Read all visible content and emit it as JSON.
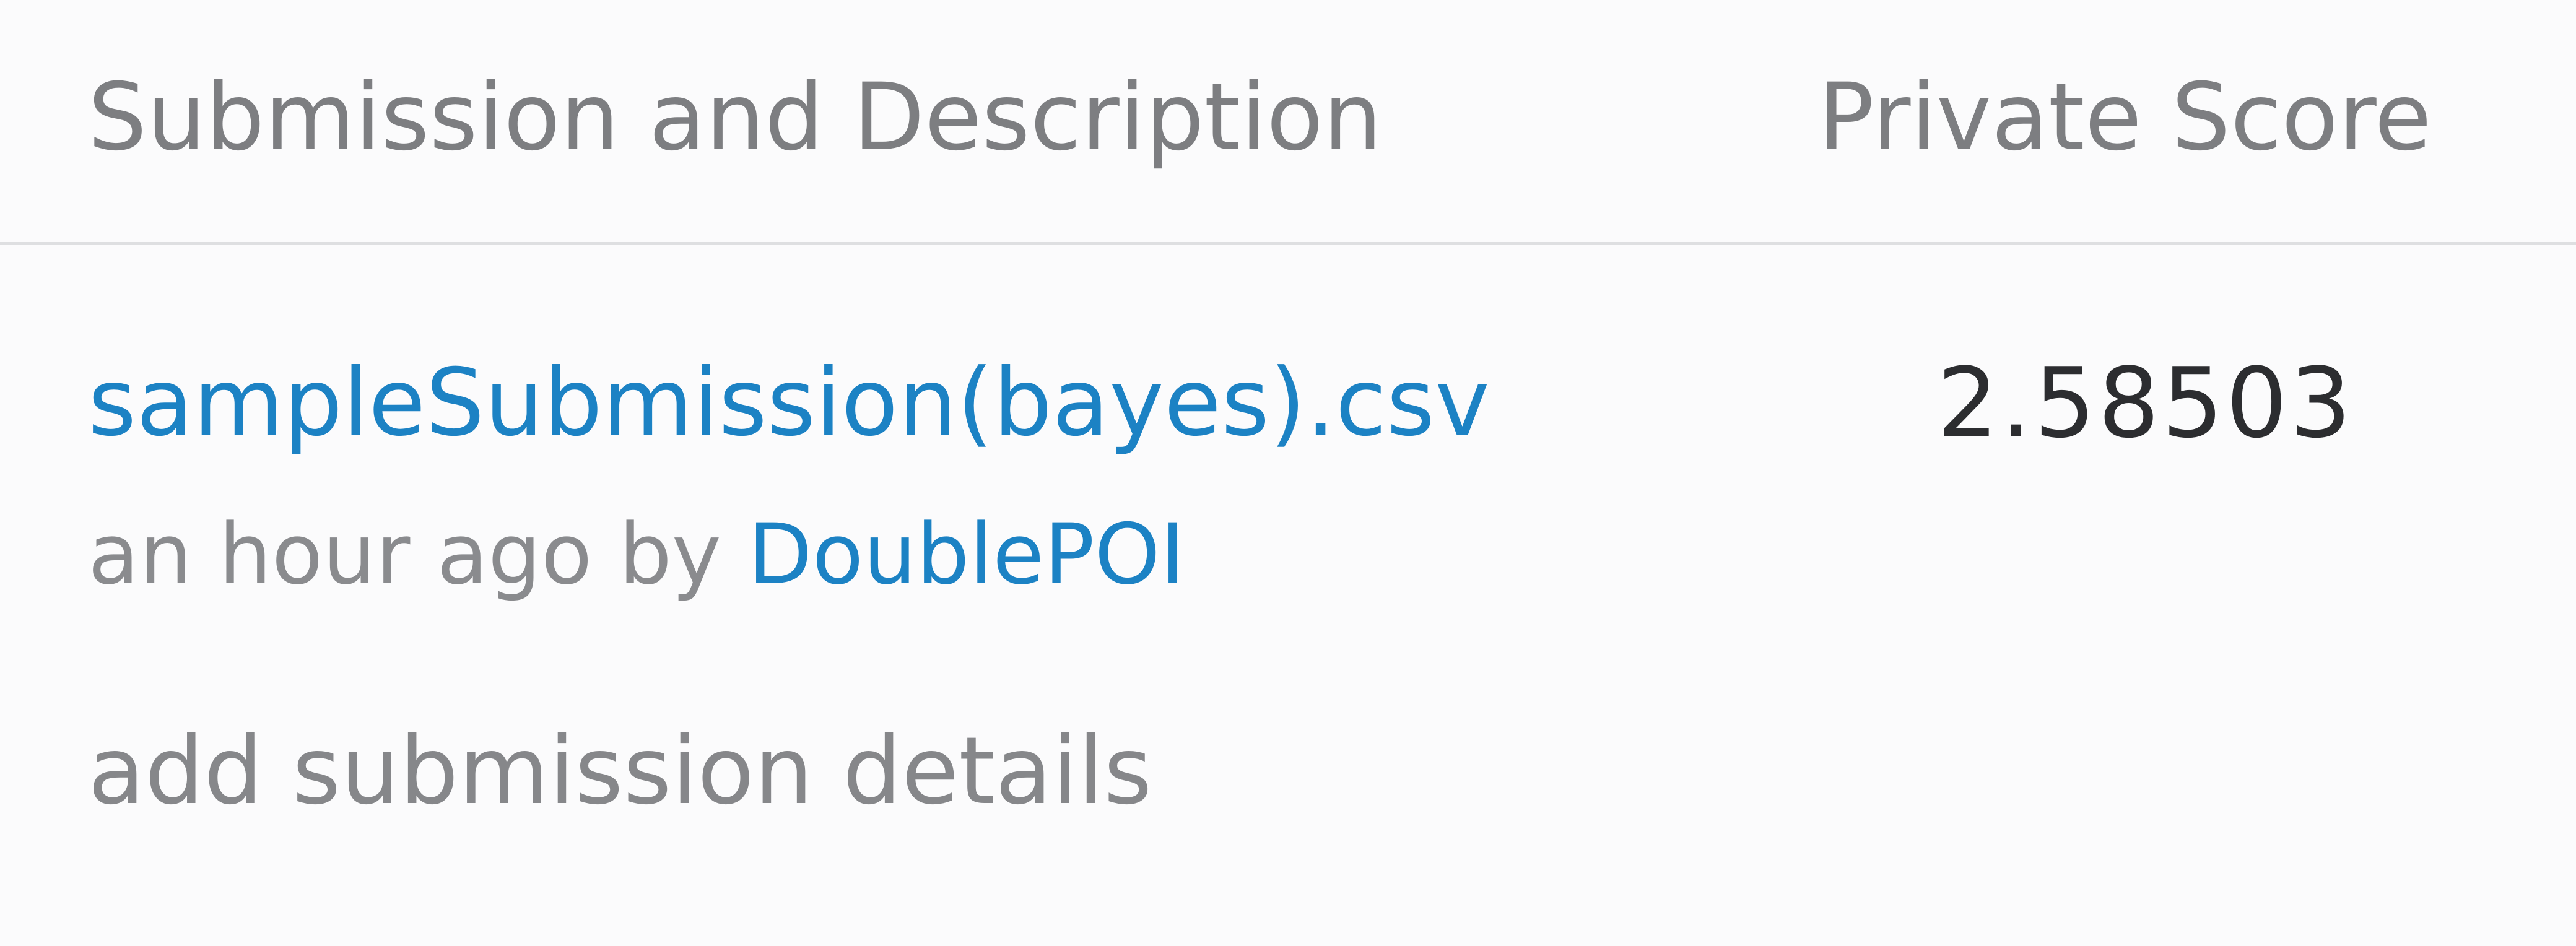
{
  "table": {
    "columns": {
      "description": "Submission and Description",
      "private_score": "Private Score"
    },
    "rows": [
      {
        "file_name": "sampleSubmission(bayes).csv",
        "time_ago": "an hour ago by",
        "user": "DoublePOI",
        "details_link": "add submission details",
        "private_score": "2.58503"
      }
    ]
  },
  "colors": {
    "link": "#1c82c4",
    "header_text": "#7d7e81",
    "muted_text": "#8a8b8e",
    "score_text": "#2c2d30",
    "divider": "#dedfe1",
    "background": "#fbfbfc"
  }
}
